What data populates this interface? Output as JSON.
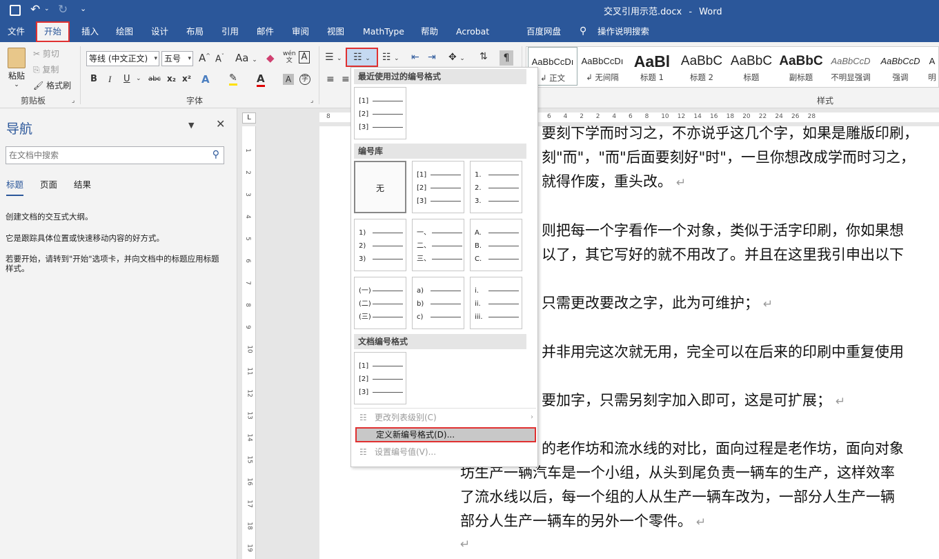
{
  "titlebar": {
    "doc_title": "交叉引用示范.docx",
    "separator": "-",
    "app": "Word"
  },
  "tabs": [
    "文件",
    "开始",
    "插入",
    "绘图",
    "设计",
    "布局",
    "引用",
    "邮件",
    "审阅",
    "视图",
    "MathType",
    "帮助",
    "Acrobat",
    "百度网盘",
    "操作说明搜索"
  ],
  "clipboard": {
    "paste": "粘贴",
    "cut": "剪切",
    "copy": "复制",
    "format_painter": "格式刷",
    "label": "剪贴板"
  },
  "font": {
    "name": "等线 (中文正文)",
    "size": "五号",
    "label": "字体",
    "grow": "A",
    "shrink": "A",
    "case": "Aa",
    "wen": "wén",
    "bold": "B",
    "italic": "I",
    "underline": "U",
    "strike": "abc",
    "sub": "x₂",
    "sup": "x²"
  },
  "styles": {
    "label": "样式",
    "items": [
      {
        "sample": "AaBbCcDı",
        "name": "↲ 正文"
      },
      {
        "sample": "AaBbCcDı",
        "name": "↲ 无间隔"
      },
      {
        "sample": "AaBl",
        "name": "标题 1"
      },
      {
        "sample": "AaBbC",
        "name": "标题 2"
      },
      {
        "sample": "AaBbC",
        "name": "标题"
      },
      {
        "sample": "AaBbC",
        "name": "副标题"
      },
      {
        "sample": "AaBbCcD",
        "name": "不明显强调"
      },
      {
        "sample": "AaBbCcD",
        "name": "强调"
      },
      {
        "sample": "A",
        "name": "明"
      }
    ]
  },
  "nav": {
    "title": "导航",
    "search_placeholder": "在文档中搜索",
    "tabs": [
      "标题",
      "页面",
      "结果"
    ],
    "msg1": "创建文档的交互式大纲。",
    "msg2": "它是跟踪具体位置或快速移动内容的好方式。",
    "msg3": "若要开始，请转到\"开始\"选项卡，并向文档中的标题应用标题样式。"
  },
  "ruler": {
    "ticks": [
      "8",
      "6",
      "4",
      "2",
      "2",
      "4",
      "6",
      "8",
      "10",
      "12",
      "14",
      "16",
      "18",
      "20",
      "22",
      "24",
      "26",
      "28"
    ],
    "vticks": [
      "1",
      "2",
      "3",
      "4",
      "5",
      "6",
      "7",
      "8",
      "9",
      "10",
      "11",
      "12",
      "13",
      "14",
      "15",
      "16",
      "17",
      "18",
      "19"
    ],
    "left_mark": "8"
  },
  "document": {
    "lines": [
      "要刻下学而时习之，不亦说乎这几个字，如果是雕版印刷，",
      "刻\"而\"，\"而\"后面要刻好\"时\"，一旦你想改成学而时习之，",
      "就得作废，重头改。",
      "则把每一个字看作一个对象，类似于活字印刷，你如果想",
      "以了，其它写好的就不用改了。并且在这里我引申出以下",
      "只需更改要改之字，此为可维护；",
      "并非用完这次就无用，完全可以在后来的印刷中重复使用",
      "要加字，只需另刻字加入即可，这是可扩展；",
      "的老作坊和流水线的对比，面向过程是老作坊，面向对象",
      "坊生产一辆汽车是一个小组，从头到尾负责一辆车的生产，这样效率",
      "了流水线以后，每一个组的人从生产一辆车改为，一部分人生产一辆",
      "部分人生产一辆车的另外一个零件。"
    ],
    "para_mark": "↵"
  },
  "menu": {
    "recent_title": "最近使用过的编号格式",
    "library_title": "编号库",
    "doc_title": "文档编号格式",
    "none_label": "无",
    "recent": [
      [
        "[1]",
        "[2]",
        "[3]"
      ]
    ],
    "library": [
      [
        "[1]",
        "[2]",
        "[3]"
      ],
      [
        "1.",
        "2.",
        "3."
      ],
      [
        "1)",
        "2)",
        "3)"
      ],
      [
        "一、",
        "二、",
        "三、"
      ],
      [
        "A.",
        "B.",
        "C."
      ],
      [
        "(一)",
        "(二)",
        "(三)"
      ],
      [
        "a)",
        "b)",
        "c)"
      ],
      [
        "i.",
        "ii.",
        "iii."
      ]
    ],
    "docfmt": [
      [
        "[1]",
        "[2]",
        "[3]"
      ]
    ],
    "change_level": "更改列表级别(C)",
    "define_new": "定义新编号格式(D)...",
    "set_value": "设置编号值(V)..."
  },
  "colors": {
    "brand": "#2b579a",
    "highlight_red": "#e03030"
  }
}
